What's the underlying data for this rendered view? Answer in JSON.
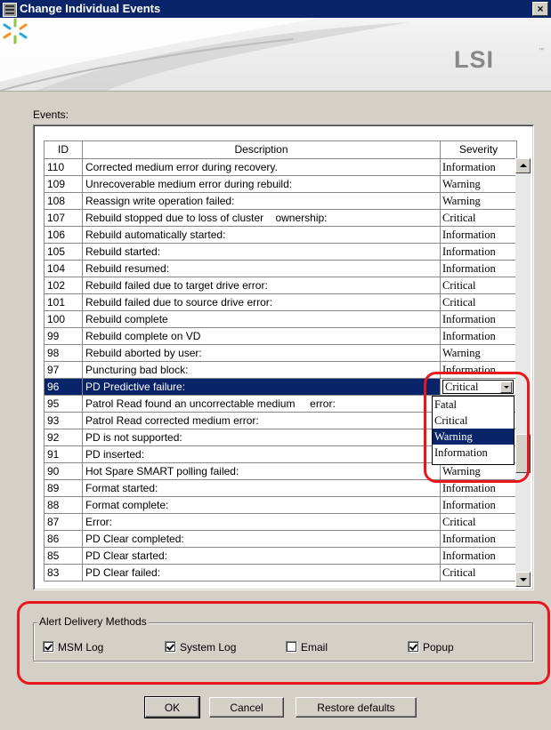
{
  "window": {
    "title": "Change Individual Events",
    "close_label": "×"
  },
  "brand": {
    "logo_text": "LSI",
    "tm": "™"
  },
  "events": {
    "label": "Events:",
    "columns": [
      "ID",
      "Description",
      "Severity"
    ],
    "rows": [
      {
        "id": "110",
        "desc": "Corrected medium error during recovery.",
        "sev": "Information"
      },
      {
        "id": "109",
        "desc": "Unrecoverable medium error during rebuild:",
        "sev": "Warning"
      },
      {
        "id": "108",
        "desc": "Reassign write operation failed:",
        "sev": "Warning"
      },
      {
        "id": "107",
        "desc": "Rebuild stopped due to loss of cluster    ownership:",
        "sev": "Critical"
      },
      {
        "id": "106",
        "desc": "Rebuild automatically started:",
        "sev": "Information"
      },
      {
        "id": "105",
        "desc": "Rebuild started:",
        "sev": "Information"
      },
      {
        "id": "104",
        "desc": "Rebuild resumed:",
        "sev": "Information"
      },
      {
        "id": "102",
        "desc": "Rebuild failed due to target drive error:",
        "sev": "Critical"
      },
      {
        "id": "101",
        "desc": "Rebuild failed due to source drive error:",
        "sev": "Critical"
      },
      {
        "id": "100",
        "desc": "Rebuild complete",
        "sev": "Information"
      },
      {
        "id": "99",
        "desc": "Rebuild complete on VD",
        "sev": "Information"
      },
      {
        "id": "98",
        "desc": "Rebuild aborted by user:",
        "sev": "Warning"
      },
      {
        "id": "97",
        "desc": "Puncturing bad block:",
        "sev": "Information"
      },
      {
        "id": "96",
        "desc": "PD Predictive failure:",
        "sev": "Critical"
      },
      {
        "id": "95",
        "desc": "Patrol Read found an uncorrectable medium     error:",
        "sev": ""
      },
      {
        "id": "93",
        "desc": "Patrol Read corrected medium error:",
        "sev": ""
      },
      {
        "id": "92",
        "desc": "PD is not supported:",
        "sev": ""
      },
      {
        "id": "91",
        "desc": "PD inserted:",
        "sev": ""
      },
      {
        "id": "90",
        "desc": "Hot Spare SMART polling failed:",
        "sev": "Warning"
      },
      {
        "id": "89",
        "desc": "Format started:",
        "sev": "Information"
      },
      {
        "id": "88",
        "desc": "Format complete:",
        "sev": "Information"
      },
      {
        "id": "87",
        "desc": "Error:",
        "sev": "Critical"
      },
      {
        "id": "86",
        "desc": "PD Clear completed:",
        "sev": "Information"
      },
      {
        "id": "85",
        "desc": "PD Clear started:",
        "sev": "Information"
      },
      {
        "id": "83",
        "desc": "PD Clear failed:",
        "sev": "Critical"
      }
    ],
    "selected_row_id": "96",
    "severity_options": [
      "Fatal",
      "Critical",
      "Warning",
      "Information"
    ],
    "highlighted_option": "Warning"
  },
  "alert_delivery": {
    "title": "Alert Delivery Methods",
    "methods": [
      {
        "label": "MSM Log",
        "checked": true
      },
      {
        "label": "System Log",
        "checked": true
      },
      {
        "label": "Email",
        "checked": false
      },
      {
        "label": "Popup",
        "checked": true
      }
    ]
  },
  "buttons": {
    "ok": "OK",
    "cancel": "Cancel",
    "restore": "Restore defaults"
  },
  "colors": {
    "titlebar": "#0a246a",
    "selection": "#0a246a",
    "annotation": "#e8161d",
    "dialog": "#d4d0c8"
  }
}
